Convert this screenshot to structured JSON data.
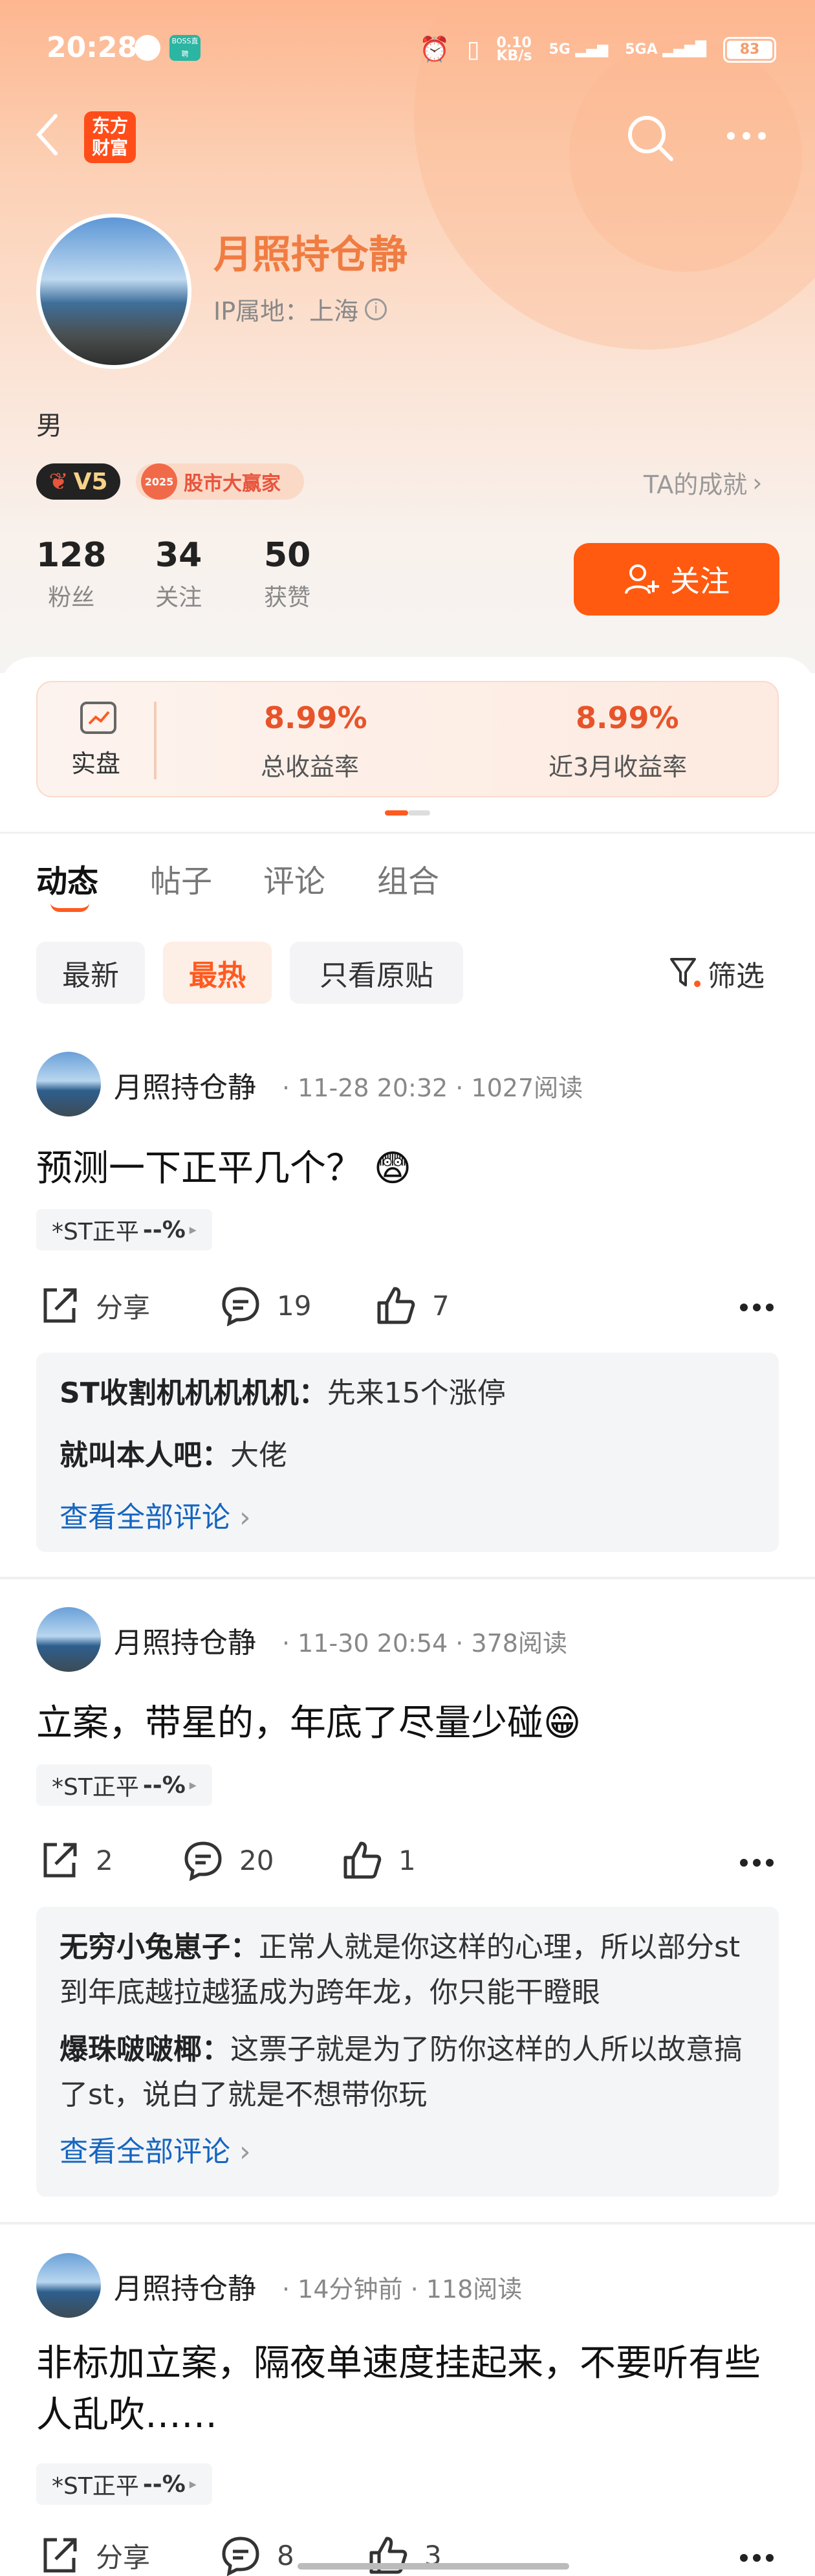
{
  "status_bar": {
    "time": "20:28",
    "net_speed_top": "0.10",
    "net_speed_unit": "KB/s",
    "sig1": "5G",
    "sig2": "5GA",
    "battery": "83",
    "boss_label": "BOSS直聘"
  },
  "header": {
    "app_logo_line1": "东方",
    "app_logo_line2": "财富"
  },
  "profile": {
    "name": "月照持仓静",
    "ip_location": "IP属地：上海",
    "gender": "男",
    "level_badge": "V5",
    "award_year": "2025",
    "award_label": "股市大赢家",
    "achievements_link": "TA的成就",
    "stats": [
      {
        "value": "128",
        "label": "粉丝"
      },
      {
        "value": "34",
        "label": "关注"
      },
      {
        "value": "50",
        "label": "获赞"
      }
    ],
    "follow_label": "关注"
  },
  "performance": {
    "account_label": "实盘",
    "total_return": "8.99%",
    "total_return_label": "总收益率",
    "recent_return": "8.99%",
    "recent_return_label": "近3月收益率"
  },
  "tabs": [
    "动态",
    "帖子",
    "评论",
    "组合"
  ],
  "filters": {
    "chips": [
      "最新",
      "最热",
      "只看原贴"
    ],
    "active": "最热",
    "filter_label": "筛选"
  },
  "posts": [
    {
      "author": "月照持仓静",
      "time": "11-28 20:32",
      "reads": "1027阅读",
      "title": "预测一下正平几个？",
      "stock": "*ST正平",
      "stock_change": "--%",
      "share": "分享",
      "comments": "19",
      "likes": "7",
      "replies": [
        {
          "user": "ST收割机机机机机：",
          "text": "先来15个涨停"
        },
        {
          "user": "就叫本人吧：",
          "text": "大佬"
        }
      ],
      "more": "查看全部评论"
    },
    {
      "author": "月照持仓静",
      "time": "11-30 20:54",
      "reads": "378阅读",
      "title": "立案，带星的，年底了尽量少碰",
      "stock": "*ST正平",
      "stock_change": "--%",
      "share": "2",
      "comments": "20",
      "likes": "1",
      "replies": [
        {
          "user": "无穷小兔崽子：",
          "text": "正常人就是你这样的心理，所以部分st到年底越拉越猛成为跨年龙，你只能干瞪眼"
        },
        {
          "user": "爆珠啵啵椰：",
          "text": "这票子就是为了防你这样的人所以故意搞了st，说白了就是不想带你玩"
        }
      ],
      "more": "查看全部评论"
    },
    {
      "author": "月照持仓静",
      "time": "14分钟前",
      "reads": "118阅读",
      "title": "非标加立案，隔夜单速度挂起来，不要听有些人乱吹……",
      "stock": "*ST正平",
      "stock_change": "--%",
      "share": "分享",
      "comments": "8",
      "likes": "3"
    }
  ]
}
